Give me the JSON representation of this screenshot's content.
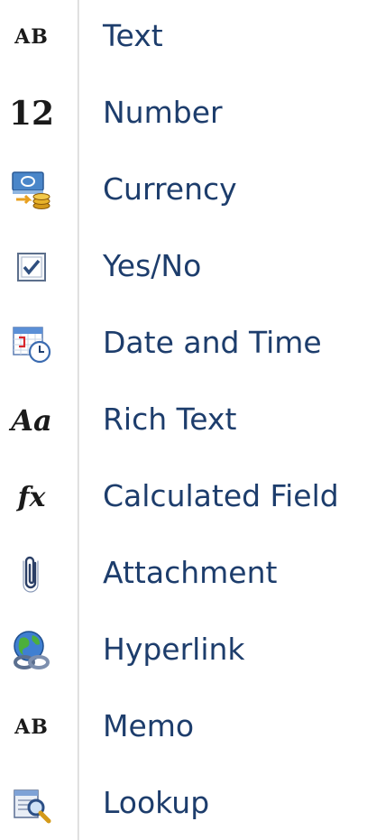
{
  "menu": {
    "items": [
      {
        "id": "text",
        "label": "Text",
        "icon": "ab-text-icon",
        "glyph": "AB"
      },
      {
        "id": "number",
        "label": "Number",
        "icon": "number-12-icon",
        "glyph": "12"
      },
      {
        "id": "currency",
        "label": "Currency",
        "icon": "currency-coins-icon"
      },
      {
        "id": "yes-no",
        "label": "Yes/No",
        "icon": "checkbox-icon"
      },
      {
        "id": "date-time",
        "label": "Date and Time",
        "icon": "calendar-clock-icon"
      },
      {
        "id": "rich-text",
        "label": "Rich Text",
        "icon": "rich-text-aa-icon",
        "glyph": "Aa"
      },
      {
        "id": "calculated-field",
        "label": "Calculated Field",
        "icon": "function-fx-icon",
        "glyph": "fx"
      },
      {
        "id": "attachment",
        "label": "Attachment",
        "icon": "paperclip-icon"
      },
      {
        "id": "hyperlink",
        "label": "Hyperlink",
        "icon": "globe-link-icon"
      },
      {
        "id": "memo",
        "label": "Memo",
        "icon": "ab-memo-icon",
        "glyph": "AB"
      },
      {
        "id": "lookup",
        "label": "Lookup",
        "icon": "lookup-magnifier-icon"
      }
    ]
  },
  "colors": {
    "label": "#1d3d6c",
    "gutter_separator": "#e8e8e8"
  }
}
